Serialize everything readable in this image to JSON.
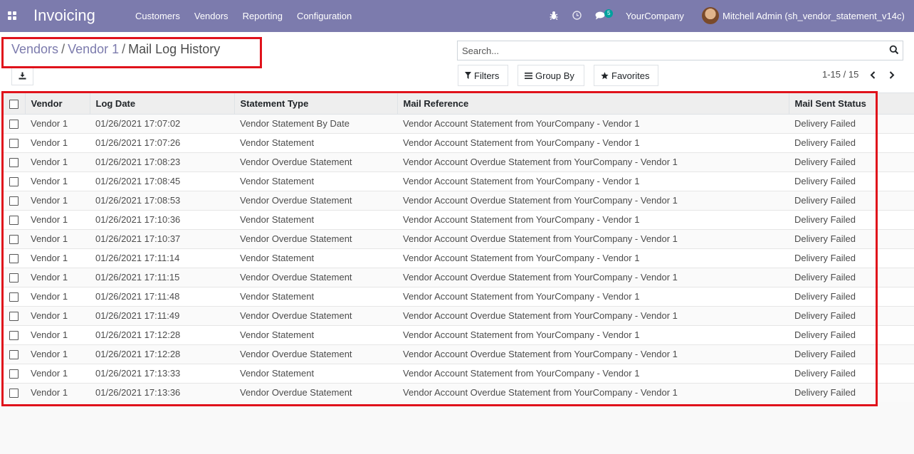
{
  "topbar": {
    "app_name": "Invoicing",
    "menu": [
      "Customers",
      "Vendors",
      "Reporting",
      "Configuration"
    ],
    "chat_badge": "5",
    "company": "YourCompany",
    "user": "Mitchell Admin (sh_vendor_statement_v14c)"
  },
  "breadcrumb": {
    "items": [
      "Vendors",
      "Vendor 1",
      "Mail Log History"
    ],
    "sep": "/"
  },
  "search": {
    "placeholder": "Search..."
  },
  "filters": {
    "filters_label": "Filters",
    "groupby_label": "Group By",
    "favorites_label": "Favorites"
  },
  "pager": {
    "value": "1-15 / 15"
  },
  "table": {
    "columns": [
      "Vendor",
      "Log Date",
      "Statement Type",
      "Mail Reference",
      "Mail Sent Status"
    ],
    "rows": [
      [
        "Vendor 1",
        "01/26/2021 17:07:02",
        "Vendor Statement By Date",
        "Vendor Account Statement from YourCompany - Vendor 1",
        "Delivery Failed"
      ],
      [
        "Vendor 1",
        "01/26/2021 17:07:26",
        "Vendor Statement",
        "Vendor Account Statement from YourCompany - Vendor 1",
        "Delivery Failed"
      ],
      [
        "Vendor 1",
        "01/26/2021 17:08:23",
        "Vendor Overdue Statement",
        "Vendor Account Overdue Statement from YourCompany - Vendor 1",
        "Delivery Failed"
      ],
      [
        "Vendor 1",
        "01/26/2021 17:08:45",
        "Vendor Statement",
        "Vendor Account Statement from YourCompany - Vendor 1",
        "Delivery Failed"
      ],
      [
        "Vendor 1",
        "01/26/2021 17:08:53",
        "Vendor Overdue Statement",
        "Vendor Account Overdue Statement from YourCompany - Vendor 1",
        "Delivery Failed"
      ],
      [
        "Vendor 1",
        "01/26/2021 17:10:36",
        "Vendor Statement",
        "Vendor Account Statement from YourCompany - Vendor 1",
        "Delivery Failed"
      ],
      [
        "Vendor 1",
        "01/26/2021 17:10:37",
        "Vendor Overdue Statement",
        "Vendor Account Overdue Statement from YourCompany - Vendor 1",
        "Delivery Failed"
      ],
      [
        "Vendor 1",
        "01/26/2021 17:11:14",
        "Vendor Statement",
        "Vendor Account Statement from YourCompany - Vendor 1",
        "Delivery Failed"
      ],
      [
        "Vendor 1",
        "01/26/2021 17:11:15",
        "Vendor Overdue Statement",
        "Vendor Account Overdue Statement from YourCompany - Vendor 1",
        "Delivery Failed"
      ],
      [
        "Vendor 1",
        "01/26/2021 17:11:48",
        "Vendor Statement",
        "Vendor Account Statement from YourCompany - Vendor 1",
        "Delivery Failed"
      ],
      [
        "Vendor 1",
        "01/26/2021 17:11:49",
        "Vendor Overdue Statement",
        "Vendor Account Overdue Statement from YourCompany - Vendor 1",
        "Delivery Failed"
      ],
      [
        "Vendor 1",
        "01/26/2021 17:12:28",
        "Vendor Statement",
        "Vendor Account Statement from YourCompany - Vendor 1",
        "Delivery Failed"
      ],
      [
        "Vendor 1",
        "01/26/2021 17:12:28",
        "Vendor Overdue Statement",
        "Vendor Account Overdue Statement from YourCompany - Vendor 1",
        "Delivery Failed"
      ],
      [
        "Vendor 1",
        "01/26/2021 17:13:33",
        "Vendor Statement",
        "Vendor Account Statement from YourCompany - Vendor 1",
        "Delivery Failed"
      ],
      [
        "Vendor 1",
        "01/26/2021 17:13:36",
        "Vendor Overdue Statement",
        "Vendor Account Overdue Statement from YourCompany - Vendor 1",
        "Delivery Failed"
      ]
    ]
  },
  "colors": {
    "topbar": "#7c7bad",
    "link": "#7c7bad",
    "highlight": "#e0121b",
    "badge": "#00a09d"
  },
  "icons": [
    "apps-icon",
    "bug-icon",
    "clock-icon",
    "chat-icon",
    "download-icon",
    "search-icon",
    "filter-icon",
    "group-by-icon",
    "star-icon",
    "chevron-left-icon",
    "chevron-right-icon"
  ]
}
